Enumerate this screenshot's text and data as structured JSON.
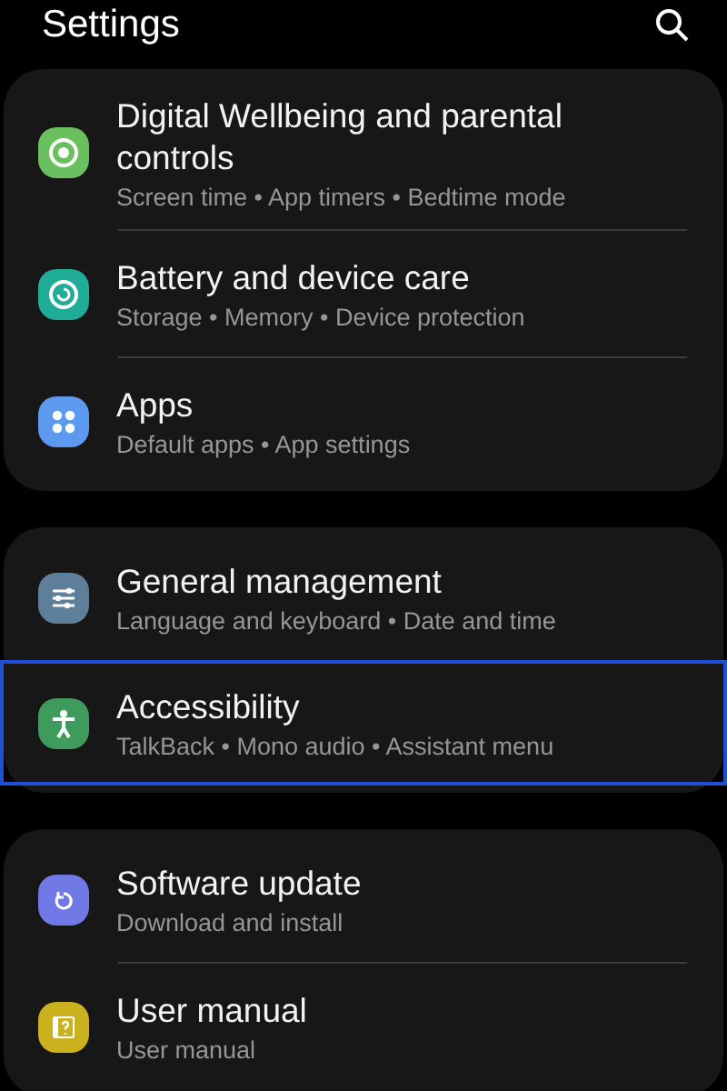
{
  "header": {
    "title": "Settings"
  },
  "groups": [
    {
      "items": [
        {
          "kind": "wellbeing",
          "color": "#6abf5e",
          "title": "Digital Wellbeing and parental controls",
          "subtitle": "Screen time • App timers • Bedtime mode",
          "selected": false
        },
        {
          "kind": "battery",
          "color": "#1fad97",
          "title": "Battery and device care",
          "subtitle": "Storage • Memory • Device protection",
          "selected": false
        },
        {
          "kind": "apps",
          "color": "#5c9af0",
          "title": "Apps",
          "subtitle": "Default apps • App settings",
          "selected": false
        }
      ]
    },
    {
      "items": [
        {
          "kind": "general",
          "color": "#5e7f99",
          "title": "General management",
          "subtitle": "Language and keyboard • Date and time",
          "selected": false
        },
        {
          "kind": "accessibility",
          "color": "#3e9a5d",
          "title": "Accessibility",
          "subtitle": "TalkBack • Mono audio • Assistant menu",
          "selected": true
        }
      ]
    },
    {
      "items": [
        {
          "kind": "update",
          "color": "#7079e6",
          "title": "Software update",
          "subtitle": "Download and install",
          "selected": false
        },
        {
          "kind": "manual",
          "color": "#c9b21d",
          "title": "User manual",
          "subtitle": "User manual",
          "selected": false
        }
      ]
    }
  ]
}
